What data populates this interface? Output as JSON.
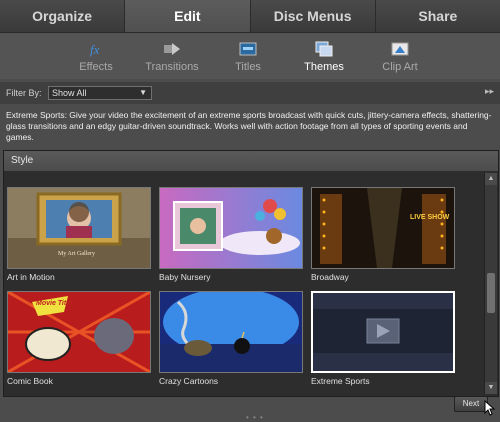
{
  "tabs": [
    {
      "label": "Organize"
    },
    {
      "label": "Edit"
    },
    {
      "label": "Disc Menus"
    },
    {
      "label": "Share"
    }
  ],
  "tools": [
    {
      "label": "Effects",
      "icon": "effects-icon"
    },
    {
      "label": "Transitions",
      "icon": "transitions-icon"
    },
    {
      "label": "Titles",
      "icon": "titles-icon"
    },
    {
      "label": "Themes",
      "icon": "themes-icon"
    },
    {
      "label": "Clip Art",
      "icon": "clip-art-icon"
    }
  ],
  "filter": {
    "label": "Filter By:",
    "value": "Show All",
    "more": "▸▸"
  },
  "description": "Extreme Sports: Give your video the excitement of an extreme sports broadcast with quick cuts, jittery-camera effects, shattering-glass transitions and an edgy guitar-driven soundtrack. Works well with action footage from all types of sporting events and games.",
  "panel": {
    "heading": "Style"
  },
  "themes": [
    {
      "name": "Art in Motion",
      "overlay": "My Art Gallery"
    },
    {
      "name": "Baby Nursery"
    },
    {
      "name": "Broadway",
      "overlay": "LIVE SHOW"
    },
    {
      "name": "Comic Book",
      "overlay": "Movie Title"
    },
    {
      "name": "Crazy Cartoons"
    },
    {
      "name": "Extreme Sports"
    }
  ],
  "footer": {
    "next_label": "Next",
    "grip": "• • •"
  }
}
